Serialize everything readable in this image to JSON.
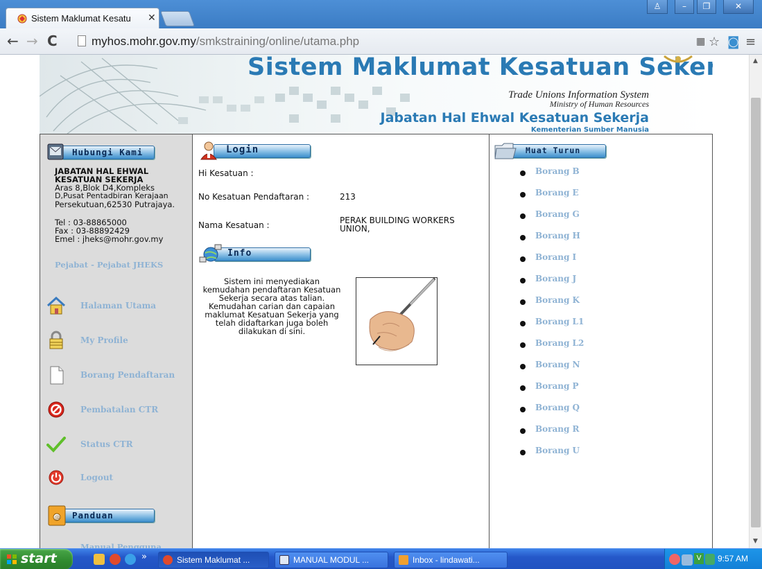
{
  "browser": {
    "tab_title": "Sistem Maklumat Kesatu",
    "url_host": "myhos.mohr.gov.my",
    "url_path": "/smkstraining/online/utama.php"
  },
  "banner": {
    "title": "Sistem Maklumat Kesatuan Sekerja",
    "subtitle_en": "Trade Unions Information System",
    "ministry_en": "Ministry of Human Resources",
    "dept": "Jabatan Hal Ehwal Kesatuan Sekerja",
    "ministry_my": "Kementerian Sumber Manusia"
  },
  "sidebar": {
    "contact_header": "Hubungi Kami",
    "org_name_1": "JABATAN HAL EHWAL",
    "org_name_2": "KESATUAN SEKERJA",
    "address_1": "Aras 8,Blok D4,Kompleks",
    "address_2": "D,Pusat Pentadbiran Kerajaan",
    "address_3": "Persekutuan,62530 Putrajaya.",
    "tel": "Tel : 03-88865000",
    "fax": "Fax : 03-88892429",
    "email": "Emel : jheks@mohr.gov.my",
    "offices_link": "Pejabat - Pejabat JHEKS",
    "menu": [
      {
        "label": "Halaman Utama",
        "icon": "home-icon"
      },
      {
        "label": "My Profile",
        "icon": "lock-icon"
      },
      {
        "label": "Borang Pendaftaran",
        "icon": "document-icon"
      },
      {
        "label": "Pembatalan CTR",
        "icon": "cancel-icon"
      },
      {
        "label": "Status CTR",
        "icon": "checkmark-icon"
      },
      {
        "label": "Logout",
        "icon": "power-icon"
      }
    ],
    "guide_header": "Panduan",
    "guide_link": "Manual Pengguna"
  },
  "login": {
    "header": "Login",
    "greeting": "Hi Kesatuan :",
    "reg_no_label": "No Kesatuan Pendaftaran :",
    "reg_no_value": "213",
    "name_label": "Nama Kesatuan :",
    "name_value_1": "PERAK BUILDING WORKERS",
    "name_value_2": "UNION,"
  },
  "info": {
    "header": "Info",
    "lines": [
      "Sistem ini menyediakan",
      "kemudahan pendaftaran Kesatuan",
      "Sekerja secara atas talian.",
      "Kemudahan carian dan capaian",
      "maklumat Kesatuan Sekerja yang",
      "telah didaftarkan juga boleh",
      "dilakukan di sini."
    ]
  },
  "downloads": {
    "header": "Muat Turun",
    "items": [
      "Borang B",
      "Borang E",
      "Borang G",
      "Borang H",
      "Borang I",
      "Borang J",
      "Borang K",
      "Borang L1",
      "Borang L2",
      "Borang N",
      "Borang P",
      "Borang Q",
      "Borang R",
      "Borang U"
    ]
  },
  "taskbar": {
    "start": "start",
    "more": "»",
    "tasks": [
      "Sistem Maklumat ...",
      "MANUAL MODUL ...",
      "Inbox - lindawati..."
    ],
    "tray_lang": "V",
    "clock": "9:57 AM"
  },
  "colors": {
    "link": "#8fb3d4",
    "banner_blue": "#2a7ab4",
    "sidebar_bg": "#dcdcdc",
    "xp_blue": "#2558c9"
  }
}
